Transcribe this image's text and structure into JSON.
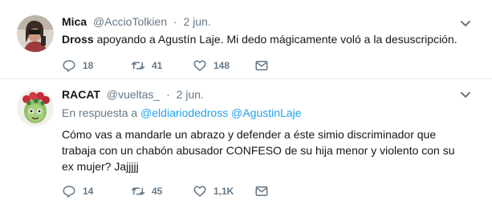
{
  "tweets": [
    {
      "name": "Mica",
      "handle": "@AccioTolkien",
      "separator": "·",
      "date": "2 jun.",
      "text_bold": "Dross",
      "text_rest": " apoyando a Agustín Laje. Mi dedo mágicamente voló a la desuscripción.",
      "replies": "18",
      "retweets": "41",
      "likes": "148"
    },
    {
      "name": "RACAT",
      "handle": "@vueltas_",
      "separator": "·",
      "date": "2 jun.",
      "reply_prefix": "En respuesta a",
      "reply_user1": "@eldiariodedross",
      "reply_user2": "@AgustinLaje",
      "text": "Cómo vas a mandarle un abrazo y defender a éste simio discriminador que trabaja con un chabón abusador CONFESO de su hija menor y violento con su ex mujer? Jajjjjj",
      "replies": "14",
      "retweets": "45",
      "likes": "1,1K"
    }
  ],
  "icons": {
    "reply": "reply-icon",
    "retweet": "retweet-icon",
    "like": "heart-icon",
    "dm": "envelope-icon",
    "caret": "chevron-down-icon"
  },
  "colors": {
    "text": "#14171a",
    "muted": "#657786",
    "link": "#1da1f2",
    "divider": "#e6ecf0"
  }
}
